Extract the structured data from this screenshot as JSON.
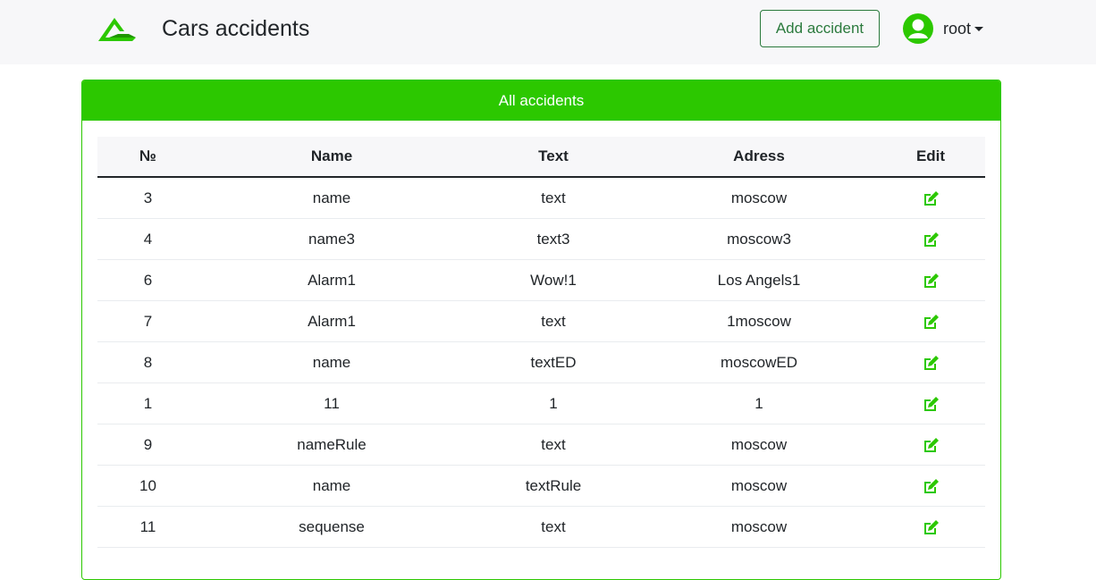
{
  "header": {
    "brand": "Cars accidents",
    "add_button": "Add accident",
    "user": "root"
  },
  "card": {
    "title": "All accidents"
  },
  "table": {
    "columns": [
      "№",
      "Name",
      "Text",
      "Adress",
      "Edit"
    ],
    "rows": [
      {
        "id": "3",
        "name": "name",
        "text": "text",
        "address": "moscow"
      },
      {
        "id": "4",
        "name": "name3",
        "text": "text3",
        "address": "moscow3"
      },
      {
        "id": "6",
        "name": "Alarm1",
        "text": "Wow!1",
        "address": "Los Angels1"
      },
      {
        "id": "7",
        "name": "Alarm1",
        "text": "text",
        "address": "1moscow"
      },
      {
        "id": "8",
        "name": "name",
        "text": "textED",
        "address": "moscowED"
      },
      {
        "id": "1",
        "name": "11",
        "text": "1",
        "address": "1"
      },
      {
        "id": "9",
        "name": "nameRule",
        "text": "text",
        "address": "moscow"
      },
      {
        "id": "10",
        "name": "name",
        "text": "textRule",
        "address": "moscow"
      },
      {
        "id": "11",
        "name": "sequense",
        "text": "text",
        "address": "moscow"
      }
    ]
  },
  "icons": {
    "logo": "logo-icon",
    "avatar": "user-circle-icon",
    "edit": "edit-icon"
  },
  "colors": {
    "accent": "#2cc800",
    "button_outline": "#2b7a3d",
    "navbar_bg": "#f7f7f9"
  }
}
